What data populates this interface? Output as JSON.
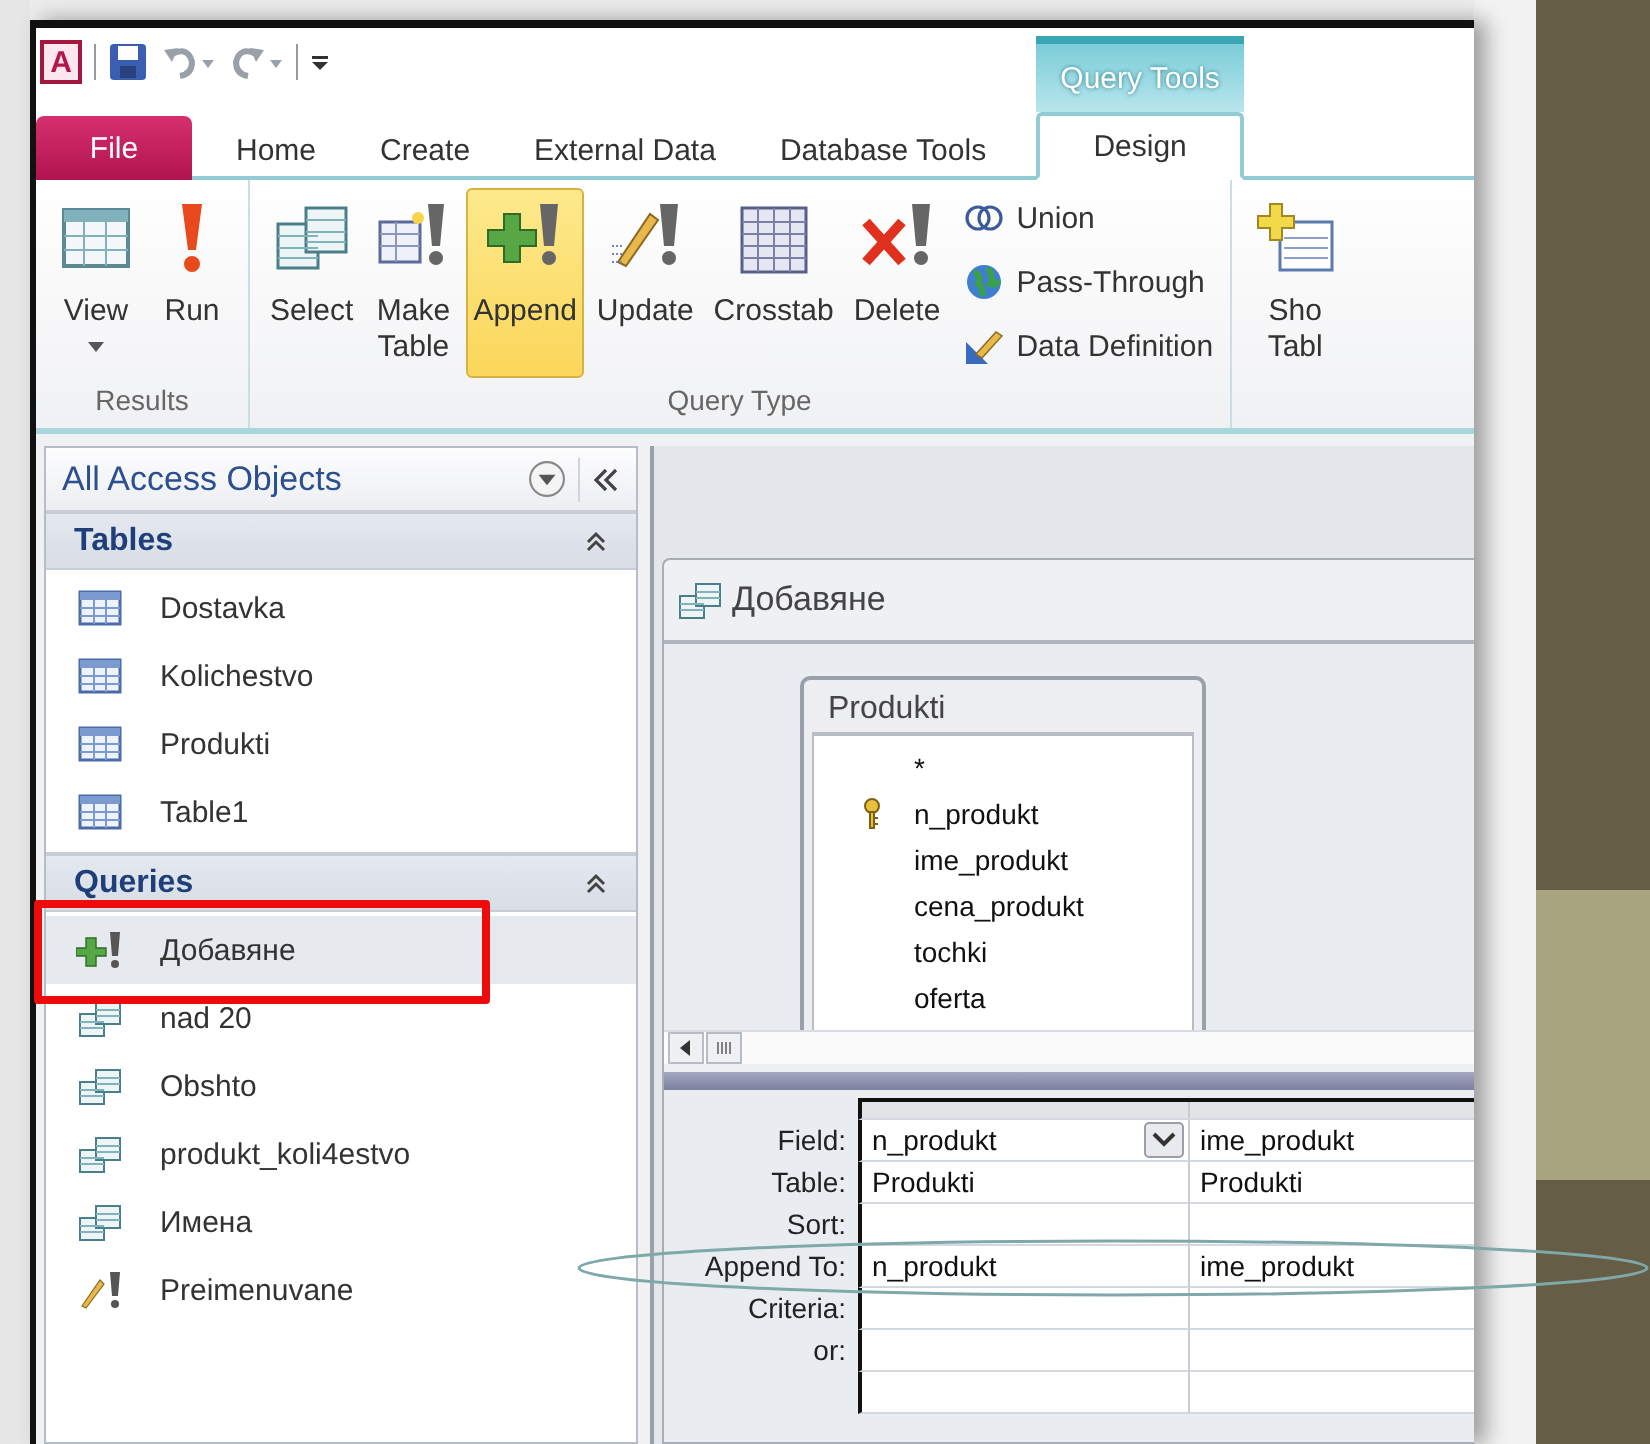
{
  "app_logo": "A",
  "contextual_tab": {
    "label": "Query Tools"
  },
  "tabs": [
    {
      "label": "File",
      "kind": "file",
      "selected": false
    },
    {
      "label": "Home",
      "kind": "plain",
      "selected": false
    },
    {
      "label": "Create",
      "kind": "plain",
      "selected": false
    },
    {
      "label": "External Data",
      "kind": "plain",
      "selected": false
    },
    {
      "label": "Database Tools",
      "kind": "plain",
      "selected": false
    },
    {
      "label": "Design",
      "kind": "contextual",
      "selected": true
    }
  ],
  "ribbon_groups": [
    {
      "label": "Results",
      "buttons": [
        {
          "lines": [
            "View"
          ],
          "kind": "view",
          "dropdown": true,
          "selected": false
        },
        {
          "lines": [
            "Run"
          ],
          "kind": "run",
          "selected": false
        }
      ]
    },
    {
      "label": "Query Type",
      "buttons": [
        {
          "lines": [
            "Select"
          ],
          "kind": "select",
          "selected": false
        },
        {
          "lines": [
            "Make",
            "Table"
          ],
          "kind": "make_table",
          "selected": false
        },
        {
          "lines": [
            "Append"
          ],
          "kind": "append",
          "selected": true
        },
        {
          "lines": [
            "Update"
          ],
          "kind": "update",
          "selected": false
        },
        {
          "lines": [
            "Crosstab"
          ],
          "kind": "crosstab",
          "selected": false
        },
        {
          "lines": [
            "Delete"
          ],
          "kind": "delete",
          "selected": false
        }
      ],
      "small_buttons": [
        {
          "label": "Union",
          "kind": "union"
        },
        {
          "label": "Pass-Through",
          "kind": "pass_through"
        },
        {
          "label": "Data Definition",
          "kind": "data_definition"
        }
      ]
    },
    {
      "buttons": [
        {
          "lines": [
            "Sho",
            "Tabl"
          ],
          "kind": "show_table",
          "selected": false
        }
      ]
    }
  ],
  "nav_pane": {
    "title": "All Access Objects",
    "groups": [
      {
        "label": "Tables",
        "expanded": true,
        "items": [
          {
            "label": "Dostavka",
            "kind": "table",
            "selected": false
          },
          {
            "label": "Kolichestvo",
            "kind": "table",
            "selected": false
          },
          {
            "label": "Produkti",
            "kind": "table",
            "selected": false
          },
          {
            "label": "Table1",
            "kind": "table",
            "selected": false
          }
        ]
      },
      {
        "label": "Queries",
        "expanded": true,
        "items": [
          {
            "label": "Добавяне",
            "kind": "append",
            "selected": true,
            "highlighted": true
          },
          {
            "label": "nad 20",
            "kind": "select",
            "selected": false,
            "highlighted": false
          },
          {
            "label": "Obshto",
            "kind": "select",
            "selected": false,
            "highlighted": false
          },
          {
            "label": "produkt_koli4estvo",
            "kind": "select",
            "selected": false,
            "highlighted": false
          },
          {
            "label": "Имена",
            "kind": "select",
            "selected": false,
            "highlighted": false
          },
          {
            "label": "Preimenuvane",
            "kind": "update",
            "selected": false,
            "highlighted": false
          }
        ]
      }
    ]
  },
  "query_window": {
    "title": "Добавяне",
    "table_box": {
      "title": "Produkti",
      "fields": [
        {
          "name": "*",
          "key": false
        },
        {
          "name": "n_produkt",
          "key": true
        },
        {
          "name": "ime_produkt",
          "key": false
        },
        {
          "name": "cena_produkt",
          "key": false
        },
        {
          "name": "tochki",
          "key": false
        },
        {
          "name": "oferta",
          "key": false
        }
      ]
    }
  },
  "grid": {
    "rows": [
      {
        "label": "Field:",
        "circled": false,
        "cells": [
          {
            "text": "n_produkt",
            "dropdown": true
          },
          {
            "text": "ime_produkt",
            "dropdown": false
          }
        ]
      },
      {
        "label": "Table:",
        "circled": false,
        "cells": [
          {
            "text": "Produkti",
            "dropdown": false
          },
          {
            "text": "Produkti",
            "dropdown": false
          }
        ]
      },
      {
        "label": "Sort:",
        "circled": false,
        "cells": []
      },
      {
        "label": "Append To:",
        "circled": true,
        "cells": [
          {
            "text": "n_produkt",
            "dropdown": false
          },
          {
            "text": "ime_produkt",
            "dropdown": false
          }
        ]
      },
      {
        "label": "Criteria:",
        "circled": false,
        "cells": []
      },
      {
        "label": "or:",
        "circled": false,
        "cells": []
      },
      {
        "label": null,
        "circled": false,
        "cells": []
      }
    ]
  }
}
